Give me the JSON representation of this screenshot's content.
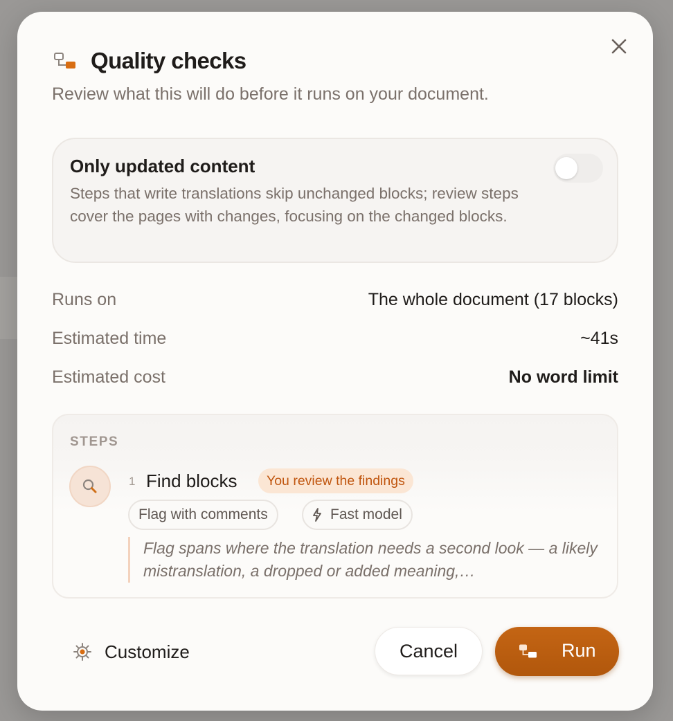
{
  "dialog": {
    "title": "Quality checks",
    "subtitle": "Review what this will do before it runs on your document.",
    "icons": {
      "header": "pipeline-icon",
      "close": "close-icon"
    }
  },
  "option": {
    "title": "Only updated content",
    "description": "Steps that write translations skip unchanged blocks; review steps cover the pages with changes, focusing on the changed blocks.",
    "toggle_on": false
  },
  "info": {
    "runs_on_label": "Runs on",
    "runs_on_value": "The whole document (17 blocks)",
    "time_label": "Estimated time",
    "time_value": "~41s",
    "cost_label": "Estimated cost",
    "cost_value": "No word limit"
  },
  "steps": {
    "heading": "STEPS",
    "items": [
      {
        "number": "1",
        "name": "Find blocks",
        "icon": "search-icon",
        "badge": "You review the findings",
        "chips": [
          {
            "label": "Flag with comments"
          },
          {
            "label": "Fast model",
            "icon": "lightning-icon"
          }
        ],
        "description": "Flag spans where the translation needs a second look — a likely mistranslation, a dropped or added meaning,…"
      }
    ]
  },
  "footer": {
    "customize_label": "Customize",
    "cancel_label": "Cancel",
    "run_label": "Run"
  },
  "colors": {
    "accent": "#b95e10",
    "badge_bg": "#fbe6d4",
    "badge_text": "#c0560f",
    "dialog_bg": "#fcfbf9",
    "muted_text": "#7a706a"
  }
}
